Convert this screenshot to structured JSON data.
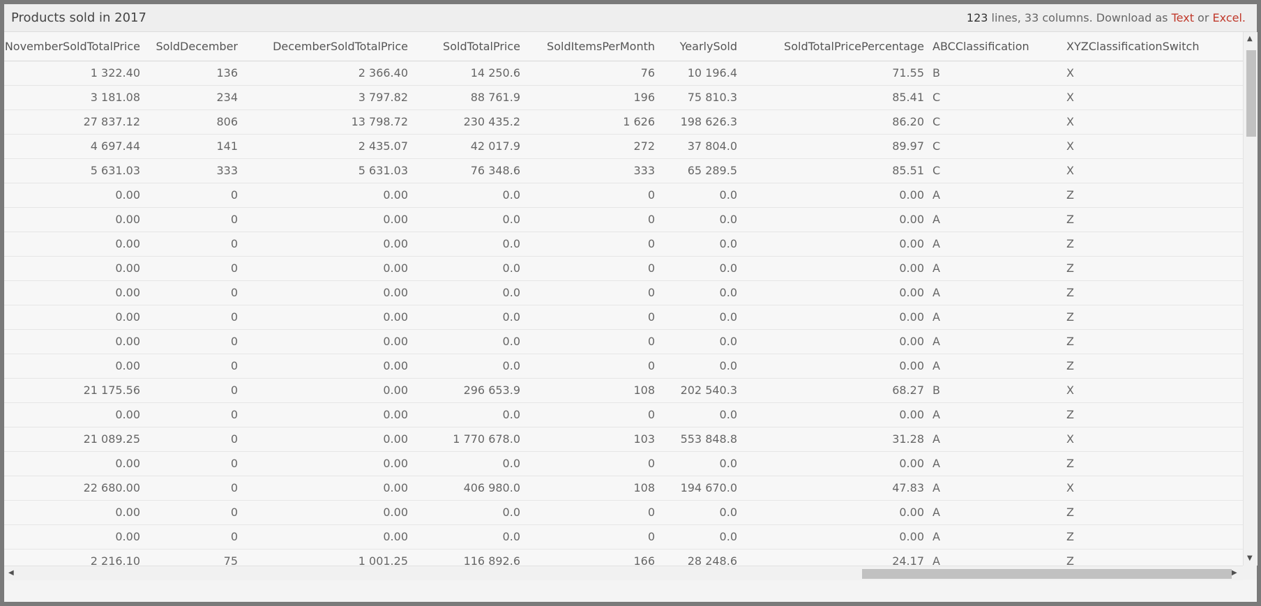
{
  "header": {
    "title": "Products sold in 2017",
    "line_count": "123",
    "summary_rest": " lines, 33 columns. Download as ",
    "text_link": "Text",
    "or_label": " or ",
    "excel_link": "Excel",
    "period": "."
  },
  "table": {
    "columns": [
      "NovemberSoldTotalPrice",
      "SoldDecember",
      "DecemberSoldTotalPrice",
      "SoldTotalPrice",
      "SoldItemsPerMonth",
      "YearlySold",
      "SoldTotalPricePercentage",
      "ABCClassification",
      "XYZClassificationSwitch"
    ],
    "rows": [
      [
        "1 322.40",
        "136",
        "2 366.40",
        "14 250.6",
        "76",
        "10 196.4",
        "71.55",
        "B",
        "X"
      ],
      [
        "3 181.08",
        "234",
        "3 797.82",
        "88 761.9",
        "196",
        "75 810.3",
        "85.41",
        "C",
        "X"
      ],
      [
        "27 837.12",
        "806",
        "13 798.72",
        "230 435.2",
        "1 626",
        "198 626.3",
        "86.20",
        "C",
        "X"
      ],
      [
        "4 697.44",
        "141",
        "2 435.07",
        "42 017.9",
        "272",
        "37 804.0",
        "89.97",
        "C",
        "X"
      ],
      [
        "5 631.03",
        "333",
        "5 631.03",
        "76 348.6",
        "333",
        "65 289.5",
        "85.51",
        "C",
        "X"
      ],
      [
        "0.00",
        "0",
        "0.00",
        "0.0",
        "0",
        "0.0",
        "0.00",
        "A",
        "Z"
      ],
      [
        "0.00",
        "0",
        "0.00",
        "0.0",
        "0",
        "0.0",
        "0.00",
        "A",
        "Z"
      ],
      [
        "0.00",
        "0",
        "0.00",
        "0.0",
        "0",
        "0.0",
        "0.00",
        "A",
        "Z"
      ],
      [
        "0.00",
        "0",
        "0.00",
        "0.0",
        "0",
        "0.0",
        "0.00",
        "A",
        "Z"
      ],
      [
        "0.00",
        "0",
        "0.00",
        "0.0",
        "0",
        "0.0",
        "0.00",
        "A",
        "Z"
      ],
      [
        "0.00",
        "0",
        "0.00",
        "0.0",
        "0",
        "0.0",
        "0.00",
        "A",
        "Z"
      ],
      [
        "0.00",
        "0",
        "0.00",
        "0.0",
        "0",
        "0.0",
        "0.00",
        "A",
        "Z"
      ],
      [
        "0.00",
        "0",
        "0.00",
        "0.0",
        "0",
        "0.0",
        "0.00",
        "A",
        "Z"
      ],
      [
        "21 175.56",
        "0",
        "0.00",
        "296 653.9",
        "108",
        "202 540.3",
        "68.27",
        "B",
        "X"
      ],
      [
        "0.00",
        "0",
        "0.00",
        "0.0",
        "0",
        "0.0",
        "0.00",
        "A",
        "Z"
      ],
      [
        "21 089.25",
        "0",
        "0.00",
        "1 770 678.0",
        "103",
        "553 848.8",
        "31.28",
        "A",
        "X"
      ],
      [
        "0.00",
        "0",
        "0.00",
        "0.0",
        "0",
        "0.0",
        "0.00",
        "A",
        "Z"
      ],
      [
        "22 680.00",
        "0",
        "0.00",
        "406 980.0",
        "108",
        "194 670.0",
        "47.83",
        "A",
        "X"
      ],
      [
        "0.00",
        "0",
        "0.00",
        "0.0",
        "0",
        "0.0",
        "0.00",
        "A",
        "Z"
      ],
      [
        "0.00",
        "0",
        "0.00",
        "0.0",
        "0",
        "0.0",
        "0.00",
        "A",
        "Z"
      ],
      [
        "2 216.10",
        "75",
        "1 001.25",
        "116 892.6",
        "166",
        "28 248.6",
        "24.17",
        "A",
        "Z"
      ]
    ]
  },
  "colors": {
    "link": "#c0392b",
    "scroll_thumb": "#c1c1c1"
  },
  "icons": {
    "scroll_up": "triangle-up-icon",
    "scroll_down": "triangle-down-icon",
    "scroll_left": "triangle-left-icon",
    "scroll_right": "triangle-right-icon"
  }
}
